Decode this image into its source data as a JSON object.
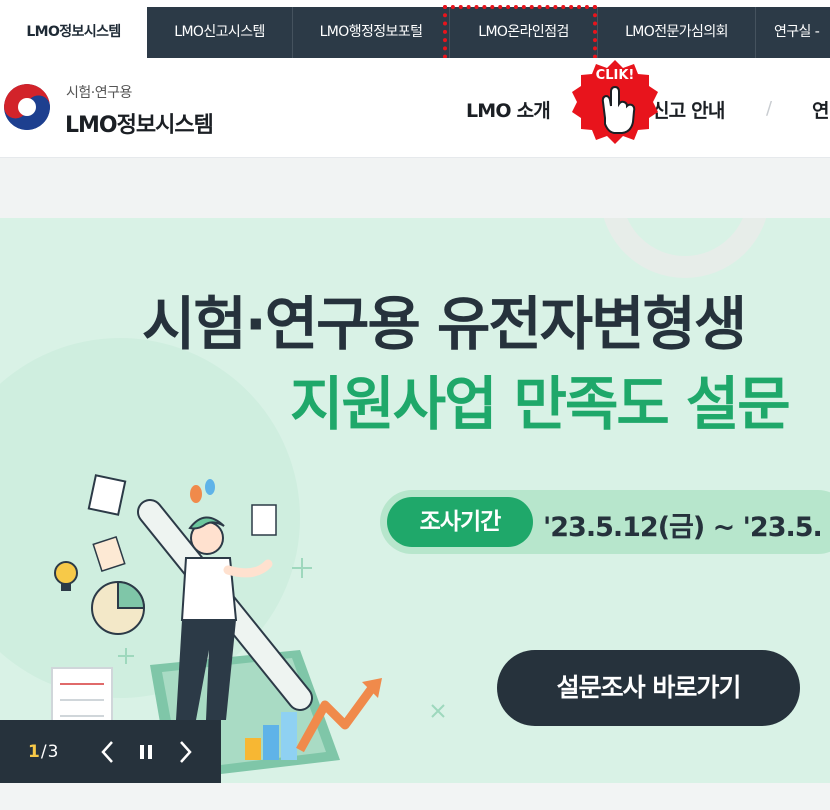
{
  "top_tabs": [
    {
      "label": "LMO정보시스템"
    },
    {
      "label": "LMO신고시스템"
    },
    {
      "label": "LMO행정정보포털"
    },
    {
      "label": "LMO온라인점검"
    },
    {
      "label": "LMO전문가심의회"
    },
    {
      "label": "연구실 -"
    }
  ],
  "click_badge": {
    "label": "CLIK!"
  },
  "logo": {
    "sub": "시험·연구용",
    "main": "LMO정보시스템"
  },
  "nav": [
    {
      "label": "LMO 소개"
    },
    {
      "label": "신고 안내"
    },
    {
      "label": "연"
    }
  ],
  "banner": {
    "title_line1": "시험·연구용 유전자변형생",
    "title_line2": "지원사업 만족도 설문",
    "period_label": "조사기간",
    "period_value": "'23.5.12(금) ~ '23.5.",
    "survey_button": "설문조사 바로가기"
  },
  "slider": {
    "current": "1",
    "total": "/3"
  },
  "colors": {
    "dark": "#26323c",
    "green": "#1fa86a",
    "mint_bg": "#d9f2e6",
    "highlight": "#e8141c"
  }
}
